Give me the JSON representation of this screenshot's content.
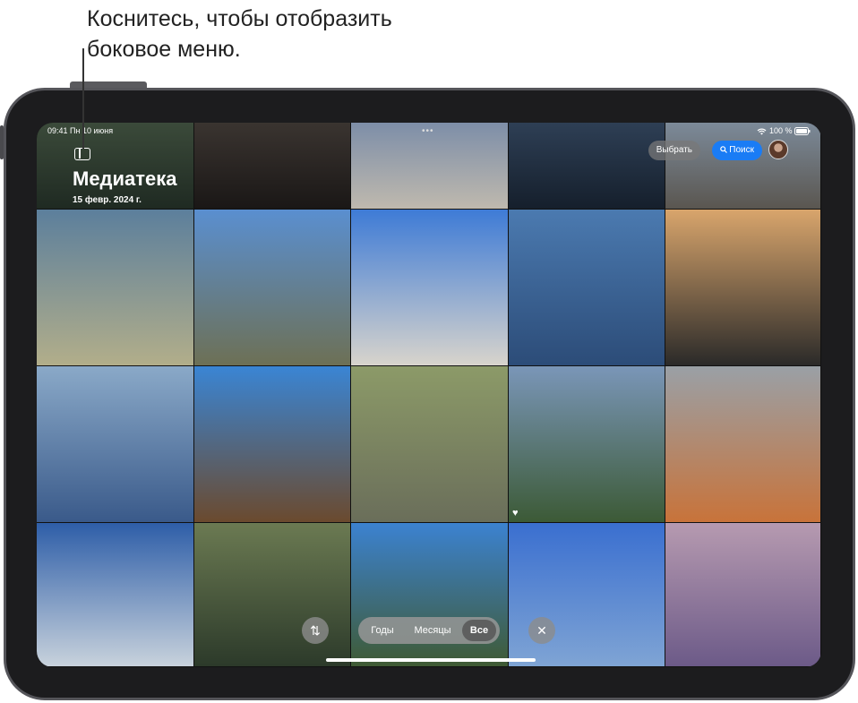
{
  "callout": {
    "line1": "Коснитесь, чтобы отобразить",
    "line2": "боковое меню."
  },
  "status_bar": {
    "time_date": "09:41  Пн 10 июня",
    "battery": "100 %",
    "dots": "•••"
  },
  "header": {
    "title": "Медиатека",
    "date": "15 февр. 2024 г.",
    "select_label": "Выбрать",
    "search_label": "Поиск"
  },
  "bottom_bar": {
    "sort_icon": "⇅",
    "tabs": [
      "Годы",
      "Месяцы",
      "Все"
    ],
    "selected_tab": "Все",
    "close_icon": "✕"
  },
  "icons": {
    "sidebar": "sidebar-icon",
    "search": "search-icon",
    "wifi": "wifi-icon",
    "battery": "battery-icon",
    "favorite": "heart-icon"
  },
  "photos": [
    {
      "label": "mountain-landscape-1",
      "c1": "#3b4a3a",
      "c2": "#1f2a22"
    },
    {
      "label": "cave-rock",
      "c1": "#3a3430",
      "c2": "#1a1716"
    },
    {
      "label": "tufa-columns-closeup",
      "c1": "#7d8ea8",
      "c2": "#bfb9ae"
    },
    {
      "label": "pond-rock",
      "c1": "#2e3f55",
      "c2": "#151f2c"
    },
    {
      "label": "rocky-shore",
      "c1": "#7c8a99",
      "c2": "#5a5650"
    },
    {
      "label": "lake-sand-ripples",
      "c1": "#5c7f9c",
      "c2": "#b2ae8a"
    },
    {
      "label": "canyon-river",
      "c1": "#5a8fd0",
      "c2": "#6d7055"
    },
    {
      "label": "tufa-towers",
      "c1": "#3e7bd6",
      "c2": "#d8d4cc"
    },
    {
      "label": "water-reflection",
      "c1": "#4b7ab0",
      "c2": "#2c4c78"
    },
    {
      "label": "lava-rocks-dusk",
      "c1": "#d9a56c",
      "c2": "#2b2a29"
    },
    {
      "label": "meadow-river",
      "c1": "#8aa9c8",
      "c2": "#3a5a8a"
    },
    {
      "label": "juniper-tree",
      "c1": "#3a85d4",
      "c2": "#6b4a2e"
    },
    {
      "label": "stream-rocks",
      "c1": "#8c9a68",
      "c2": "#6a6e5a"
    },
    {
      "label": "wetland-flowers",
      "c1": "#7a96b8",
      "c2": "#3c5a36"
    },
    {
      "label": "lichen-rock",
      "c1": "#9aa0a6",
      "c2": "#c8733a"
    },
    {
      "label": "cloudy-sky",
      "c1": "#2e5ea8",
      "c2": "#c8d2dc"
    },
    {
      "label": "underwater-plants",
      "c1": "#6b7a52",
      "c2": "#2c3a2a"
    },
    {
      "label": "pine-forest",
      "c1": "#3c82d0",
      "c2": "#3f5a34"
    },
    {
      "label": "pink-flower-blue",
      "c1": "#3a6fd0",
      "c2": "#7fa4d4"
    },
    {
      "label": "purple-flower-pink",
      "c1": "#b69ab0",
      "c2": "#6c5a88"
    }
  ]
}
